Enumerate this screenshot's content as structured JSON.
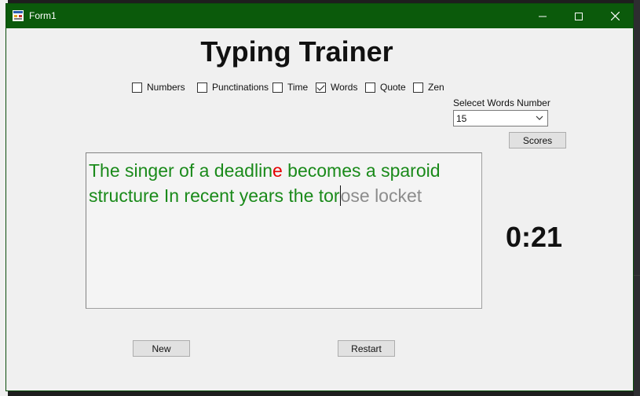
{
  "window": {
    "title": "Form1"
  },
  "app": {
    "heading": "Typing Trainer"
  },
  "options": [
    {
      "label": "Numbers",
      "checked": false
    },
    {
      "label": "Punctinations",
      "checked": false
    },
    {
      "label": "Time",
      "checked": false
    },
    {
      "label": "Words",
      "checked": true
    },
    {
      "label": "Quote",
      "checked": false
    },
    {
      "label": "Zen",
      "checked": false
    }
  ],
  "words_select": {
    "label": "Selecet Words Number",
    "value": "15"
  },
  "buttons": {
    "scores": "Scores",
    "new": "New",
    "restart": "Restart"
  },
  "typing": {
    "line1_a": "The singer of a deadlin",
    "line1_err": "e",
    "line1_b": " becomes a sparoid",
    "line2_typed": "structure In recent years the tor",
    "line2_rest": "ose locket"
  },
  "timer": "0:21",
  "colors": {
    "titlebar": "#0b5a0b",
    "correct": "#1a8a1a",
    "error": "#e60000",
    "pending": "#8c8c8c"
  }
}
